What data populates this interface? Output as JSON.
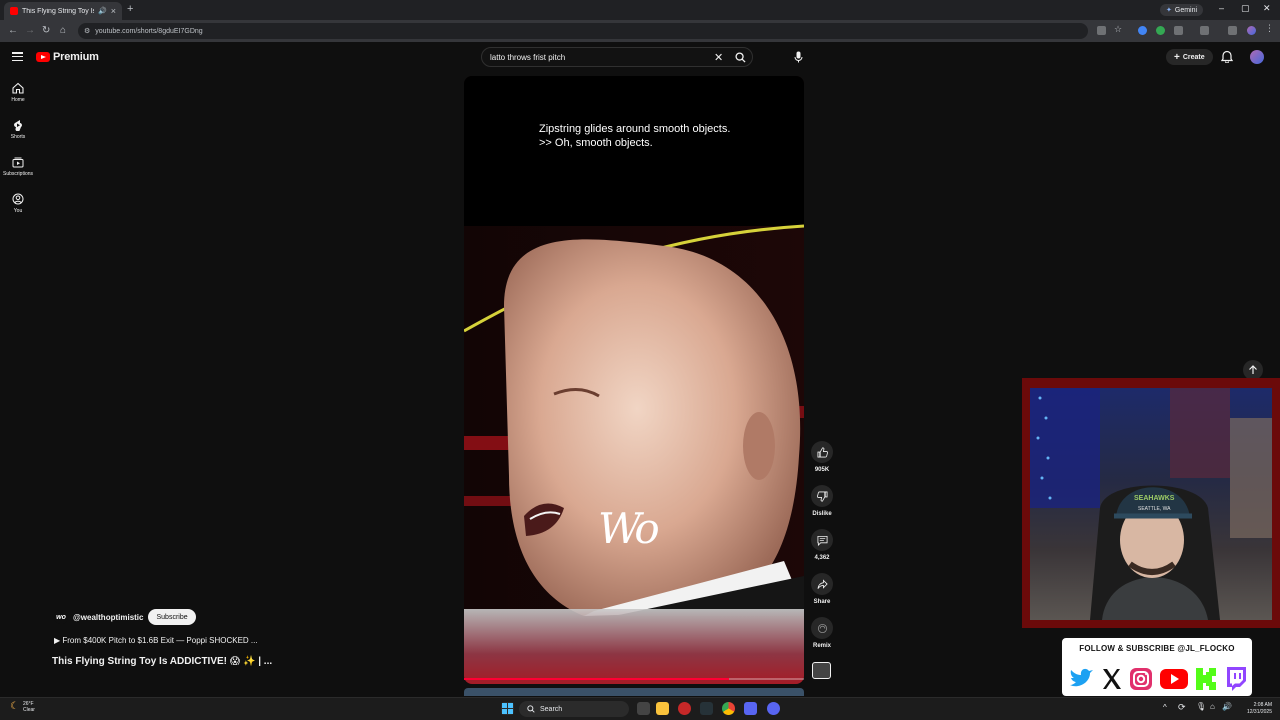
{
  "browser": {
    "tab_title": "This Flying String Toy Is ADDICTIVE!",
    "new_tab": "+",
    "gemini_label": "Gemini",
    "url": "youtube.com/shorts/8gduEI7GDng",
    "window_controls": [
      "–",
      "▢",
      "✕"
    ]
  },
  "youtube": {
    "logo_text": "Premium",
    "search_query": "latto throws frist pitch",
    "create_label": "Create",
    "rail": [
      {
        "label": "Home",
        "icon": "home-icon"
      },
      {
        "label": "Shorts",
        "icon": "shorts-icon"
      },
      {
        "label": "Subscriptions",
        "icon": "subscriptions-icon"
      },
      {
        "label": "You",
        "icon": "you-icon"
      }
    ]
  },
  "short": {
    "caption_line1": "Zipstring glides around smooth objects.",
    "caption_line2": ">> Oh, smooth objects.",
    "watermark": "Wo",
    "progress_fraction": 0.78,
    "channel_handle": "@wealthoptimistic",
    "subscribe_label": "Subscribe",
    "description": "▶ From $400K Pitch to $1.6B Exit — Poppi SHOCKED ...",
    "title": "This Flying String Toy Is ADDICTIVE! 😱 ✨ | ...",
    "actions": [
      {
        "label": "905K",
        "icon": "like-icon"
      },
      {
        "label": "Dislike",
        "icon": "dislike-icon"
      },
      {
        "label": "4,362",
        "icon": "comment-icon"
      },
      {
        "label": "Share",
        "icon": "share-icon"
      },
      {
        "label": "Remix",
        "icon": "remix-icon"
      }
    ]
  },
  "overlay": {
    "follow_text": "FOLLOW & SUBSCRIBE @JL_FLOCKO",
    "cap_text": "SEAHAWKS",
    "cap_subtext": "SEATTLE, WA",
    "socials": [
      {
        "name": "twitter-icon",
        "color": "#1da1f2"
      },
      {
        "name": "x-icon",
        "color": "#000000"
      },
      {
        "name": "instagram-icon",
        "color": "#e1306c"
      },
      {
        "name": "youtube-icon",
        "color": "#ff0000"
      },
      {
        "name": "kick-icon",
        "color": "#53fc18"
      },
      {
        "name": "twitch-icon",
        "color": "#9146ff"
      }
    ]
  },
  "taskbar": {
    "weather_temp": "26°F",
    "weather_desc": "Clear",
    "search_label": "Search",
    "time": "2:08 AM",
    "date": "12/31/2025"
  },
  "colors": {
    "background": "#0f0f0f",
    "accent_red": "#ff0033",
    "cam_border": "#6b0a0a"
  }
}
